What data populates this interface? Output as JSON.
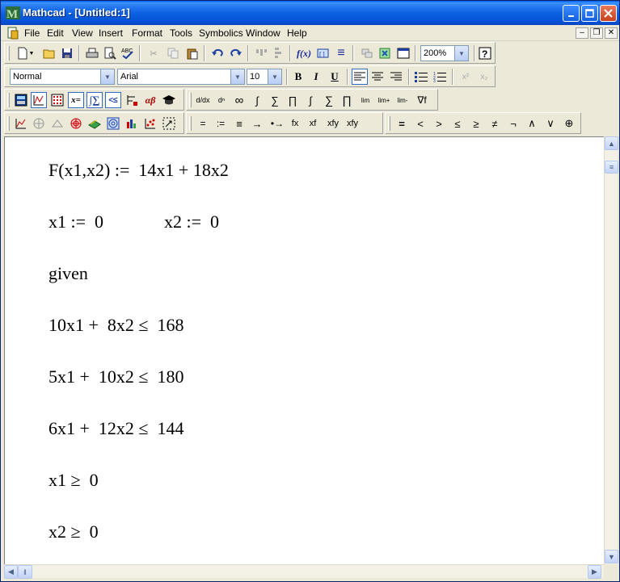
{
  "window": {
    "title": "Mathcad - [Untitled:1]"
  },
  "menu": [
    "File",
    "Edit",
    "View",
    "Insert",
    "Format",
    "Tools",
    "Symbolics",
    "Window",
    "Help"
  ],
  "toolbar_standard": {
    "zoom": "200%"
  },
  "toolbar_format": {
    "style": "Normal",
    "font": "Arial",
    "size": "10"
  },
  "toolbar_math_eval": [
    "=",
    ":=",
    "≡",
    "→",
    "•→",
    "fx",
    "xf",
    "xfy",
    "xfy"
  ],
  "toolbar_boolean": [
    "=",
    "<",
    ">",
    "≤",
    "≥",
    "≠",
    "¬",
    "∧",
    "∨",
    "⊕"
  ],
  "document": {
    "lines": [
      "F(x1,x2) :=  14x1 + 18x2",
      "x1 :=  0",
      "x2 :=  0",
      "given",
      "10x1 +  8x2 ≤  168",
      "5x1 +  10x2 ≤  180",
      "6x1 +  12x2 ≤  144",
      "x1 ≥  0",
      "x2 ≥  0"
    ]
  },
  "colors": {
    "title_bar": "#0a5ee0",
    "close_button": "#c8401f",
    "document_bg": "#ffffff"
  }
}
